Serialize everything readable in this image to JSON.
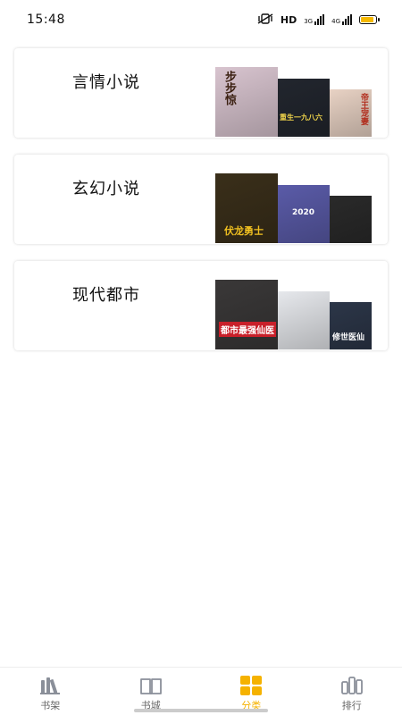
{
  "status_bar": {
    "time": "15:48",
    "network_label": "HD",
    "signal_1_label": "3G",
    "signal_2_label": "4G",
    "battery_color": "#f5b800",
    "battery_level": 0.9
  },
  "categories": [
    {
      "title": "言情小说",
      "covers": [
        {
          "text": "步步惊",
          "bg": "#d8c4cf",
          "fg": "#3a1f10"
        },
        {
          "text": "重生一九八六",
          "bg": "#22262e",
          "fg": "#f2d64b"
        },
        {
          "text": "帝王宠妻",
          "bg": "#e8d2c4",
          "fg": "#b12a1a"
        }
      ]
    },
    {
      "title": "玄幻小说",
      "covers": [
        {
          "text": "伏龙勇士",
          "bg": "#3a2f1a",
          "fg": "#f0c020"
        },
        {
          "text": "2020",
          "bg": "#5a5ba8",
          "fg": "#ffffff"
        },
        {
          "text": "",
          "bg": "#2a2a2a",
          "fg": "#ffffff"
        }
      ]
    },
    {
      "title": "现代都市",
      "covers": [
        {
          "text": "都市最强仙医",
          "bg": "#3a3838",
          "fg": "#ffffff"
        },
        {
          "text": "",
          "bg": "#e6e8ec",
          "fg": "#333"
        },
        {
          "text": "修世医仙",
          "bg": "#2c3648",
          "fg": "#ffffff"
        }
      ]
    }
  ],
  "nav": {
    "items": [
      {
        "label": "书架",
        "icon": "bookshelf-icon"
      },
      {
        "label": "书城",
        "icon": "open-book-icon"
      },
      {
        "label": "分类",
        "icon": "grid-category-icon"
      },
      {
        "label": "排行",
        "icon": "ranking-bars-icon"
      }
    ],
    "active_index": 2,
    "active_color": "#f5b200",
    "inactive_color": "#8a8f99"
  }
}
